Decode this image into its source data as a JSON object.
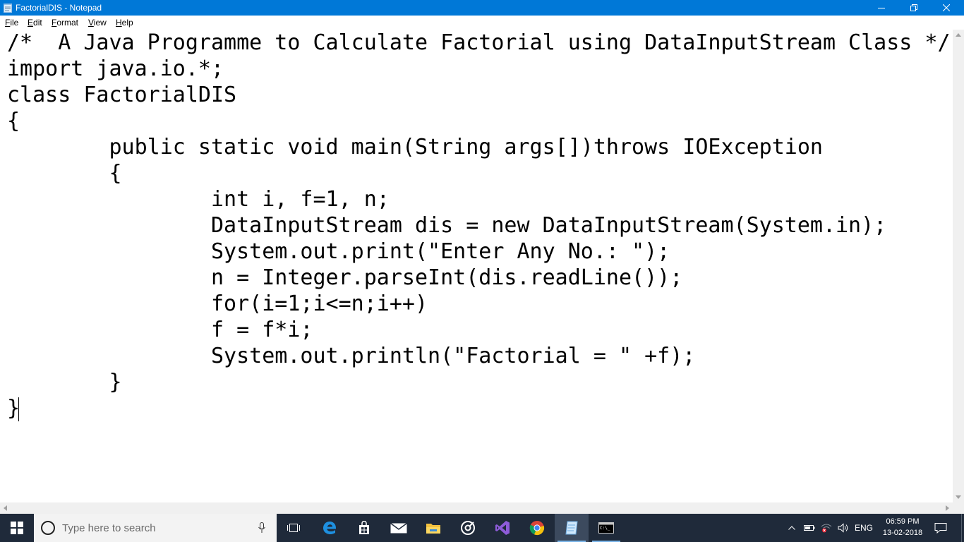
{
  "window": {
    "title": "FactorialDIS - Notepad"
  },
  "menu": {
    "file": "File",
    "edit": "Edit",
    "format": "Format",
    "view": "View",
    "help": "Help"
  },
  "editor": {
    "lines": [
      "/*  A Java Programme to Calculate Factorial using DataInputStream Class */",
      "import java.io.*;",
      "class FactorialDIS",
      "{",
      "\tpublic static void main(String args[])throws IOException",
      "\t{",
      "\t\tint i, f=1, n;",
      "\t\tDataInputStream dis = new DataInputStream(System.in);",
      "\t\tSystem.out.print(\"Enter Any No.: \");",
      "\t\tn = Integer.parseInt(dis.readLine());",
      "\t\tfor(i=1;i<=n;i++)",
      "\t\tf = f*i;",
      "\t\tSystem.out.println(\"Factorial = \" +f);",
      "\t}",
      "}"
    ]
  },
  "taskbar": {
    "search_placeholder": "Type here to search",
    "language": "ENG",
    "time": "06:59 PM",
    "date": "13-02-2018"
  },
  "colors": {
    "titlebar": "#0078d7",
    "taskbar": "#1f2a3a",
    "search_box": "#f3f3f3"
  }
}
